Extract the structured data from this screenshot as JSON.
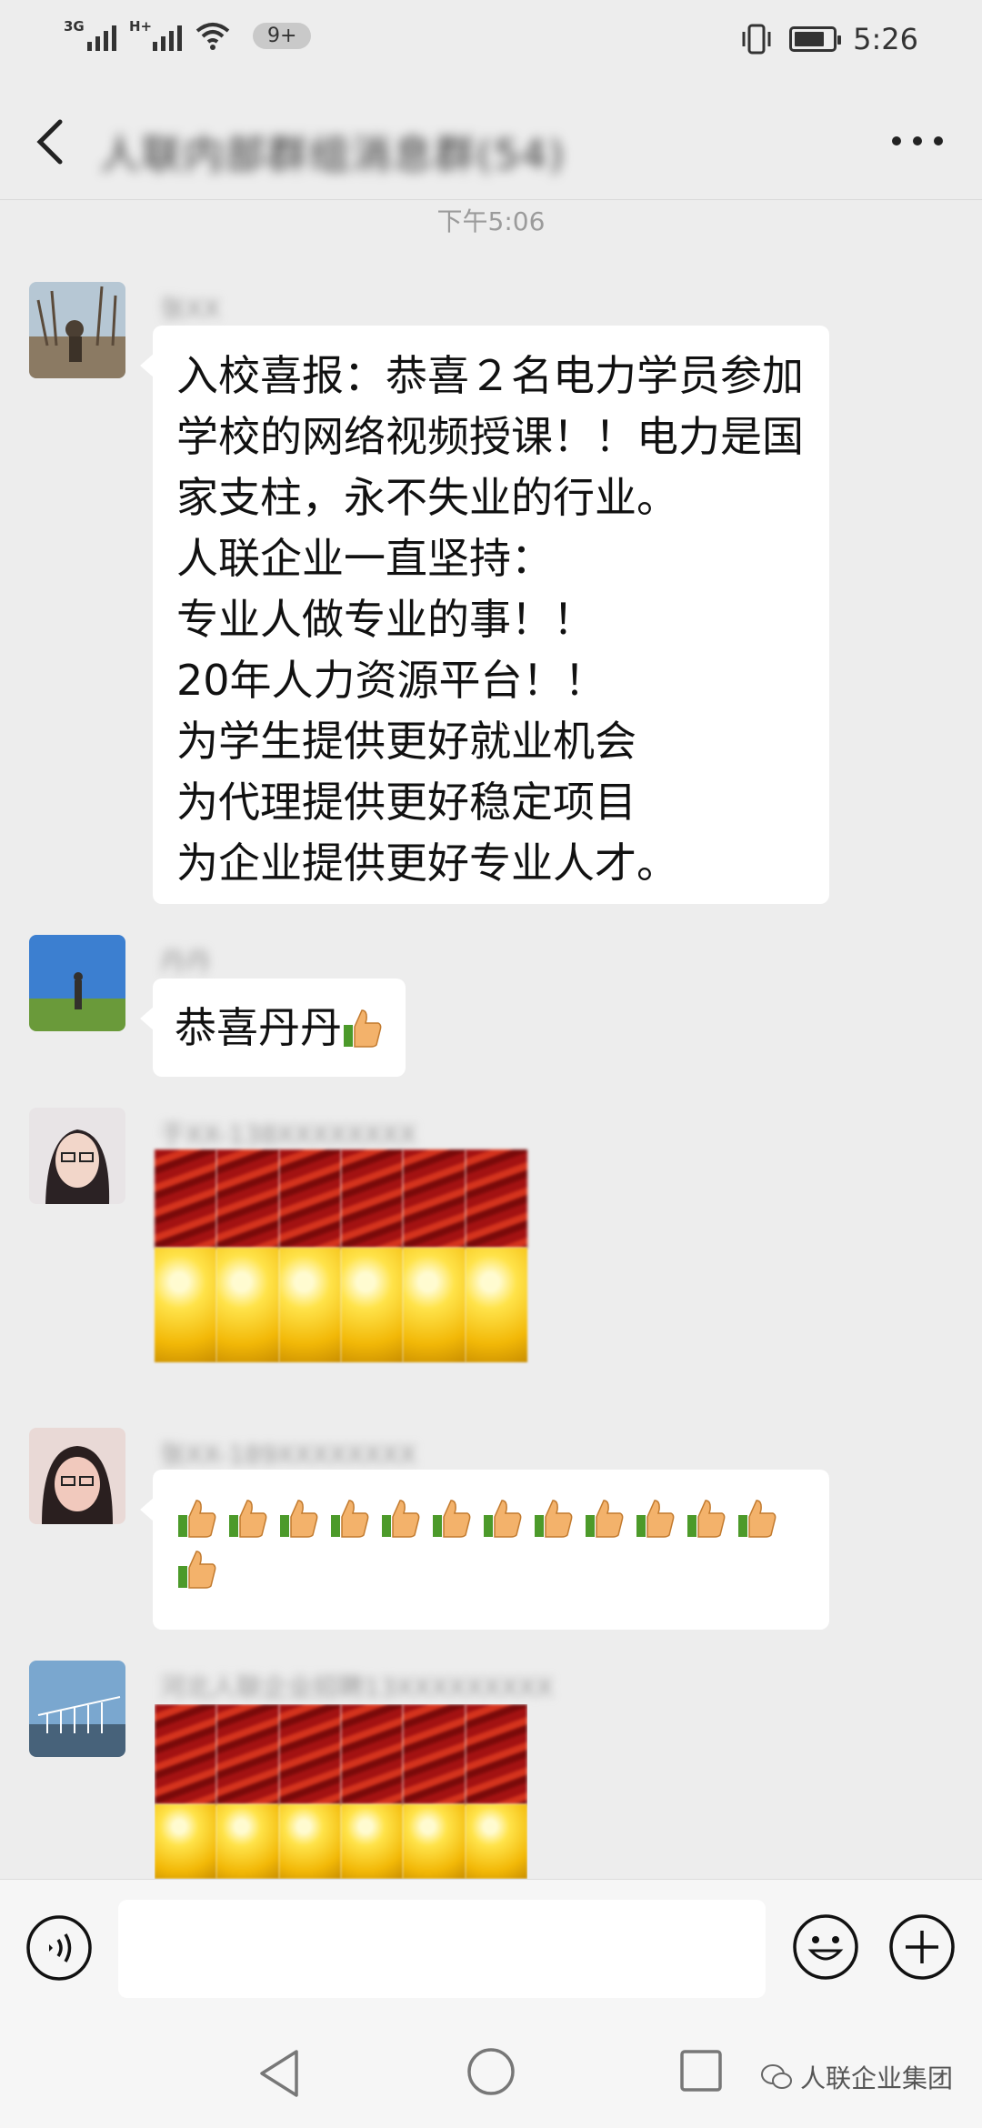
{
  "status_bar": {
    "network1": "3G",
    "network2": "H+",
    "notification_badge": "9+",
    "time": "5:26",
    "battery_level": 0.78
  },
  "title_bar": {
    "chat_title": "人联内部群组消息群(54)"
  },
  "timestamp": "下午5:06",
  "messages": [
    {
      "sender": "张XX",
      "lines": [
        "入校喜报：恭喜２名电力学员参加",
        "学校的网络视频授课！！电力是国",
        "家支柱，永不失业的行业。",
        "人联企业一直坚持：",
        "专业人做专业的事！！",
        "20年人力资源平台！！",
        "为学生提供更好就业机会",
        "为代理提供更好稳定项目",
        "为企业提供更好专业人才。"
      ]
    },
    {
      "sender": "丹丹",
      "text": "恭喜丹丹"
    },
    {
      "sender": "于XX-138XXXXXXXX"
    },
    {
      "sender": "张XX-189XXXXXXXX",
      "thumb_count": 13
    },
    {
      "sender": "河北人联企业招聘13XXXXXXXXX"
    }
  ],
  "watermark": "人联企业集团",
  "icons": {
    "back": "chevron-left-icon",
    "more": "more-dots-icon",
    "voice": "voice-icon",
    "emoji": "emoji-icon",
    "plus": "plus-icon"
  }
}
